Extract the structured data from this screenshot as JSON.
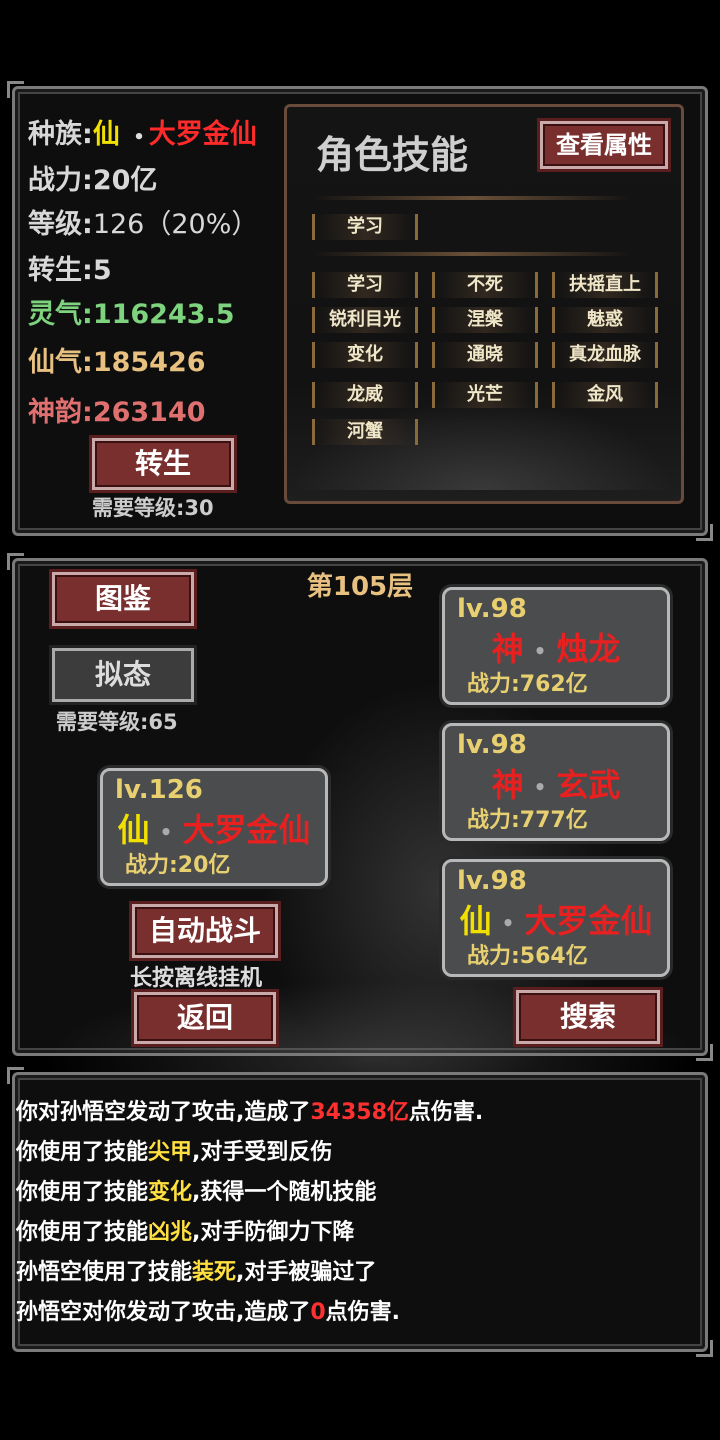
{
  "stats": {
    "race_label": "种族:",
    "race_value": "仙",
    "race_dot": "•",
    "race_rank": "大罗金仙",
    "power_label": "战力:",
    "power_value": "20亿",
    "level_label": "等级:",
    "level_value": "126（20%）",
    "rebirth_label": "转生:",
    "rebirth_value": "5",
    "lingqi_label": "灵气:",
    "lingqi_value": "116243.5",
    "xianqi_label": "仙气:",
    "xianqi_value": "185426",
    "shenyun_label": "神韵:",
    "shenyun_value": "263140",
    "rebirth_button": "转生",
    "rebirth_req": "需要等级:30"
  },
  "skills_panel": {
    "title": "角色技能",
    "view_attr_button": "查看属性",
    "learn_slot": "学习",
    "skills": [
      "学习",
      "不死",
      "扶摇直上",
      "锐利目光",
      "涅槃",
      "魅惑",
      "变化",
      "通晓",
      "真龙血脉",
      "龙威",
      "光芒",
      "金风",
      "河蟹"
    ]
  },
  "battle": {
    "floor": "第105层",
    "codex_button": "图鉴",
    "mimic_button": "拟态",
    "mimic_req": "需要等级:65",
    "auto_button": "自动战斗",
    "auto_hint": "长按离线挂机",
    "back_button": "返回",
    "search_button": "搜索",
    "player": {
      "lv": "lv.126",
      "race": "仙",
      "dot": "•",
      "rank": "大罗金仙",
      "power": "战力:20亿"
    },
    "enemies": [
      {
        "lv": "lv.98",
        "race": "神",
        "dot": "•",
        "rank": "烛龙",
        "power": "战力:762亿"
      },
      {
        "lv": "lv.98",
        "race": "神",
        "dot": "•",
        "rank": "玄武",
        "power": "战力:777亿"
      },
      {
        "lv": "lv.98",
        "race": "仙",
        "dot": "•",
        "rank": "大罗金仙",
        "power": "战力:564亿"
      }
    ]
  },
  "log": [
    {
      "pre": "你对孙悟空发动了攻击,造成了",
      "hl": "34358亿",
      "post": "点伤害.",
      "color": "#ff3030"
    },
    {
      "pre": "你使用了技能",
      "hl": "尖甲",
      "post": ",对手受到反伤",
      "color": "#ffe040"
    },
    {
      "pre": "你使用了技能",
      "hl": "变化",
      "post": ",获得一个随机技能",
      "color": "#ffe040"
    },
    {
      "pre": "你使用了技能",
      "hl": "凶兆",
      "post": ",对手防御力下降",
      "color": "#ffe040"
    },
    {
      "pre": "孙悟空使用了技能",
      "hl": "装死",
      "post": ",对手被骗过了",
      "color": "#ffe040"
    },
    {
      "pre": "孙悟空对你发动了攻击,造成了",
      "hl": "0",
      "post": "点伤害.",
      "color": "#ff3030"
    }
  ],
  "colors": {
    "red": "#e82020",
    "yellow": "#f2e000",
    "green": "#7ed37e",
    "gold": "#e8c080",
    "rose": "#e07070"
  }
}
